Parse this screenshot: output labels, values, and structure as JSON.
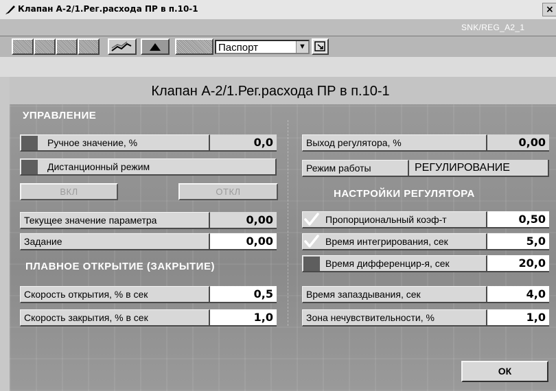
{
  "window": {
    "title": "Клапан А-2/1.Рег.расхода ПР в п.10-1",
    "close_label": "×",
    "id_label": "SNK/REG_A2_1"
  },
  "toolbar": {
    "view_select": "Паспорт",
    "dropdown_arrow": "▼"
  },
  "main": {
    "title": "Клапан А-2/1.Рег.расхода ПР в п.10-1"
  },
  "control": {
    "heading": "УПРАВЛЕНИЕ",
    "manual_label": "Ручное значение, %",
    "manual_value": "0,0",
    "remote_label": "Дистанционный режим",
    "on_label": "ВКЛ",
    "off_label": "ОТКЛ",
    "current_label": "Текущее значение параметра",
    "current_value": "0,00",
    "setpoint_label": "Задание",
    "setpoint_value": "0,00"
  },
  "smooth": {
    "heading": "ПЛАВНОЕ ОТКРЫТИЕ (ЗАКРЫТИЕ)",
    "open_label": "Скорость открытия, % в сек",
    "open_value": "0,5",
    "close_label": "Скорость закрытия, % в сек",
    "close_value": "1,0"
  },
  "regulator": {
    "output_label": "Выход регулятора, %",
    "output_value": "0,00",
    "mode_label": "Режим работы",
    "mode_value": "РЕГУЛИРОВАНИЕ"
  },
  "settings": {
    "heading": "НАСТРОЙКИ РЕГУЛЯТОРА",
    "kp_label": "Пропорциональный коэф-т",
    "kp_value": "0,50",
    "ti_label": "Время интегрирования, сек",
    "ti_value": "5,0",
    "td_label": "Время дифференцир-я, сек",
    "td_value": "20,0",
    "delay_label": "Время запаздывания, сек",
    "delay_value": "4,0",
    "deadband_label": "Зона нечувствительности, %",
    "deadband_value": "1,0"
  },
  "footer": {
    "ok_label": "ОК"
  },
  "icons": {
    "title": "pen-icon",
    "trend": "trend-icon",
    "up": "triangle-up-icon",
    "expand": "expand-icon",
    "check": "checkmark-icon"
  }
}
